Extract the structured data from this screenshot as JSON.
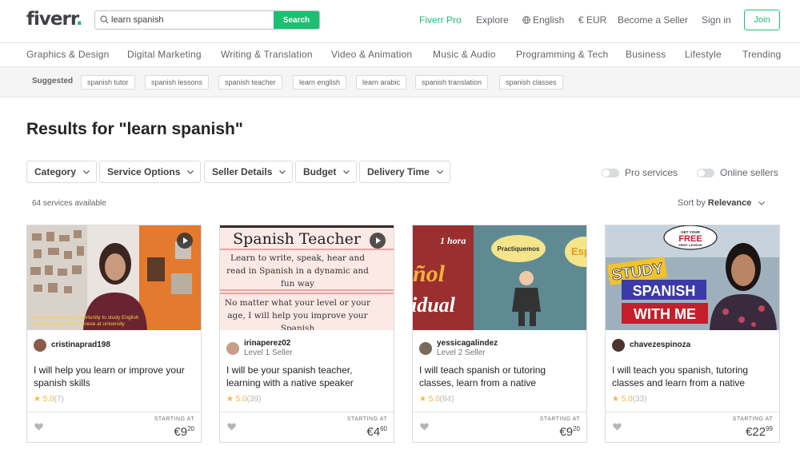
{
  "header": {
    "logo_text": "fiverr",
    "logo_dot": ".",
    "search_value": "learn spanish",
    "search_button": "Search",
    "nav": {
      "pro": "Fiverr Pro",
      "explore": "Explore",
      "language": "English",
      "currency": "€ EUR",
      "become_seller": "Become a Seller",
      "sign_in": "Sign in",
      "join": "Join"
    }
  },
  "categories": [
    "Graphics & Design",
    "Digital Marketing",
    "Writing & Translation",
    "Video & Animation",
    "Music & Audio",
    "Programming & Tech",
    "Business",
    "Lifestyle",
    "Trending"
  ],
  "suggested": {
    "label": "Suggested",
    "chips": [
      "spanish tutor",
      "spanish lessons",
      "spanish teacher",
      "learn english",
      "learn arabic",
      "spanish translation",
      "spanish classes"
    ]
  },
  "results": {
    "title": "Results for \"learn spanish\"",
    "filters": [
      "Category",
      "Service Options",
      "Seller Details",
      "Budget",
      "Delivery Time"
    ],
    "toggles": [
      "Pro services",
      "Online sellers"
    ],
    "count": "64 services available",
    "sort_label": "Sort by",
    "sort_value": "Relevance"
  },
  "thumb_text": {
    "t1_caption_1": "I had the amazing opportunity to study English",
    "t1_caption_2": "French and a little Chinese at university",
    "t2_title": "Spanish Teacher",
    "t2_line1": "Learn to write, speak, hear and",
    "t2_line2": "read in Spanish in a dynamic and",
    "t2_line3": "fun way",
    "t2_line4": "No matter what your level or your",
    "t2_line5": "age, I will help you improve your",
    "t2_line6": "Spanish",
    "t3_hour": "1 hora",
    "t3_bubble": "Practiquemos",
    "t3_es": "Esp",
    "t3_big1": "ñol",
    "t3_big2": "idual",
    "t4_free_1": "GET YOUR",
    "t4_free_2": "FREE",
    "t4_free_3": "FIRST LESSON",
    "t4_study": "STUDY",
    "t4_spanish": "SPANISH",
    "t4_with": "WITH ME"
  },
  "cards": [
    {
      "seller": "cristinaprad198",
      "level": "",
      "title": "I will help you learn or improve your spanish skills",
      "rating": "5.0",
      "reviews": "(7)",
      "starting": "STARTING AT",
      "price": "€9",
      "cents": "20"
    },
    {
      "seller": "irinaperez02",
      "level": "Level 1 Seller",
      "title": "I will be your spanish teacher, learning with a native speaker",
      "rating": "5.0",
      "reviews": "(39)",
      "starting": "STARTING AT",
      "price": "€4",
      "cents": "60"
    },
    {
      "seller": "yessicagalindez",
      "level": "Level 2 Seller",
      "title": "I will teach spanish or tutoring classes, learn from a native",
      "rating": "5.0",
      "reviews": "(84)",
      "starting": "STARTING AT",
      "price": "€9",
      "cents": "20"
    },
    {
      "seller": "chavezespinoza",
      "level": "",
      "title": "I will teach you spanish, tutoring classes and learn from a native",
      "rating": "5.0",
      "reviews": "(33)",
      "starting": "STARTING AT",
      "price": "€22",
      "cents": "99"
    }
  ],
  "colors": {
    "brand": "#1dbf73",
    "star": "#ffb33e",
    "text": "#404145"
  },
  "icons": [
    "search-icon",
    "globe-icon",
    "chevron-down-icon",
    "heart-icon",
    "star-icon",
    "play-icon"
  ]
}
